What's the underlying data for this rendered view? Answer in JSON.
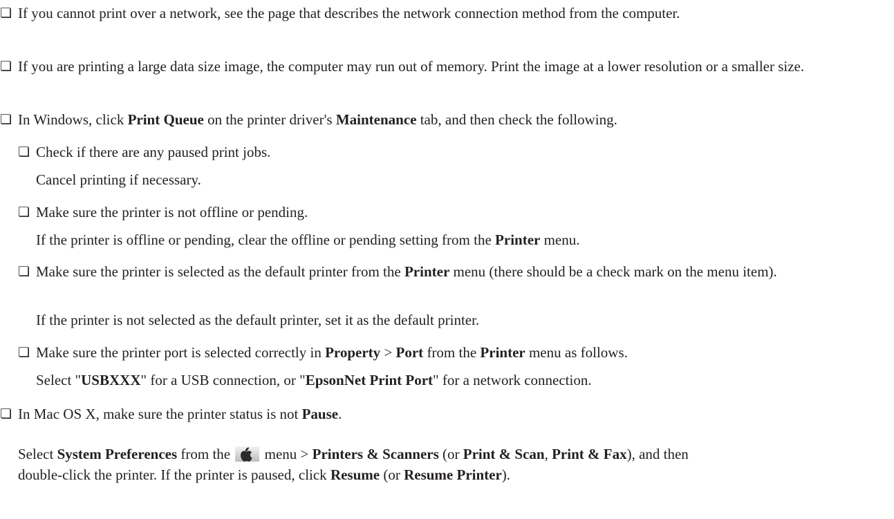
{
  "items": [
    {
      "box": "❏",
      "text": "If you cannot print over a network, see the page that describes the network connection method from the computer."
    },
    {
      "box": "❏",
      "text": "If you are printing a large data size image, the computer may run out of memory. Print the image at a lower resolution or a smaller size."
    },
    {
      "box": "❏",
      "t1": "In Windows, click ",
      "b1": "Print Queue",
      "t2": " on the printer driver's ",
      "b2": "Maintenance",
      "t3": " tab, and then check the following."
    }
  ],
  "sub": [
    {
      "box": "❏",
      "text": "Check if there are any paused print jobs.",
      "note": "Cancel printing if necessary."
    },
    {
      "box": "❏",
      "text": "Make sure the printer is not offline or pending.",
      "note_t1": "If the printer is offline or pending, clear the offline or pending setting from the ",
      "note_b1": "Printer",
      "note_t2": " menu."
    },
    {
      "box": "❏",
      "t1": "Make sure the printer is selected as the default printer from the ",
      "b1": "Printer",
      "t2": " menu (there should be a check mark on the menu item).",
      "note": "If the printer is not selected as the default printer, set it as the default printer."
    },
    {
      "box": "❏",
      "t1": "Make sure the printer port is selected correctly in ",
      "b1": "Property",
      "t2": " > ",
      "b2": "Port",
      "t3": " from the ",
      "b3": "Printer",
      "t4": " menu as follows.",
      "note_t1": "Select \"",
      "note_b1": "USBXXX",
      "note_t2": "\" for a USB connection, or \"",
      "note_b2": "EpsonNet Print Port",
      "note_t3": "\" for a network connection."
    }
  ],
  "mac": {
    "box": "❏",
    "t1": "In Mac OS X, make sure the printer status is not ",
    "b1": "Pause",
    "t2": ".",
    "p1": "Select ",
    "p1b": "System Preferences",
    "p2": " from the ",
    "p3": " menu > ",
    "p3b": "Printers & Scanners",
    "p4": " (or ",
    "p4b": "Print & Scan",
    "p5": ", ",
    "p5b": "Print & Fax",
    "p6": "), and then",
    "q1": "double-click the printer. If the printer is paused, click ",
    "q1b": "Resume",
    "q2": " (or ",
    "q2b": "Resume Printer",
    "q3": ")."
  },
  "icons": {
    "apple_menu": "apple-icon"
  }
}
